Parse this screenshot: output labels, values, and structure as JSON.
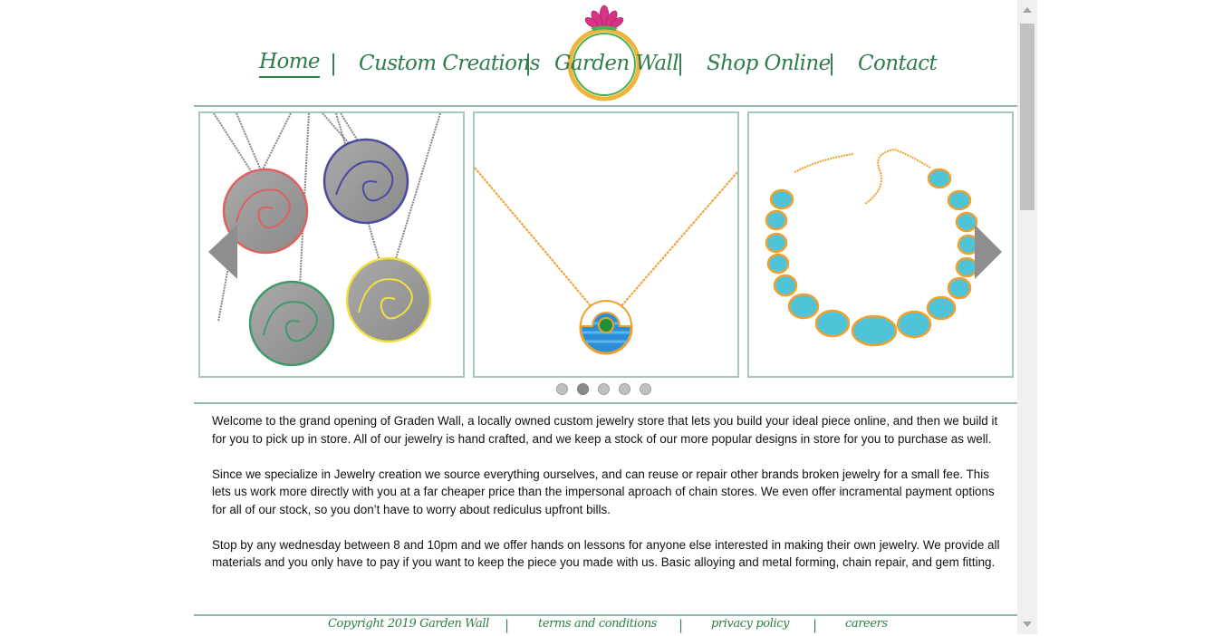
{
  "nav": {
    "items": [
      {
        "label": "Home",
        "active": true
      },
      {
        "label": "Custom Creations"
      },
      {
        "label": "Garden Wall"
      },
      {
        "label": "Shop Online"
      },
      {
        "label": "Contact"
      }
    ],
    "separator": "|"
  },
  "logo": {
    "icon": "lotus-ring-logo",
    "colors": {
      "lotus": "#d63384",
      "ring": "#f0b43c",
      "ring_inner": "#4caf50"
    }
  },
  "slider": {
    "slides": [
      {
        "icon": "spiral-pendants-image"
      },
      {
        "icon": "blue-pendant-necklace-image"
      },
      {
        "icon": "turquoise-bead-necklace-image"
      }
    ],
    "active_dot": 1,
    "dot_count": 5
  },
  "content": {
    "paragraphs": [
      "Welcome to the grand opening of Graden Wall, a locally owned custom jewelry store that lets you build your ideal piece online, and then we build it for you to pick up in store. All of our jewelry is hand crafted, and we keep a stock of our more popular designs in store for you to purchase as well.",
      "Since we specialize in Jewelry creation we source everything ourselves, and can reuse or repair other brands broken jewelry for a small fee. This lets us work more directly with you at a far cheaper price than the impersonal aproach of chain stores. We even offer incramental payment options for all of our stock, so you don’t have to worry about rediculus upfront bills.",
      "Stop by any wednesday between 8 and 10pm and we offer hands on lessons for anyone else interested in making their own jewelry. We provide all materials and you only have to pay if you want to keep the piece you made with us. Basic alloying and metal forming, chain repair, and gem fitting."
    ]
  },
  "footer": {
    "copyright": "Copyright 2019 Garden Wall",
    "links": [
      "terms and conditions",
      "privacy policy",
      "careers"
    ],
    "separator": "|"
  },
  "colors": {
    "accent": "#2e7d4a",
    "border": "#8fb8a8"
  }
}
